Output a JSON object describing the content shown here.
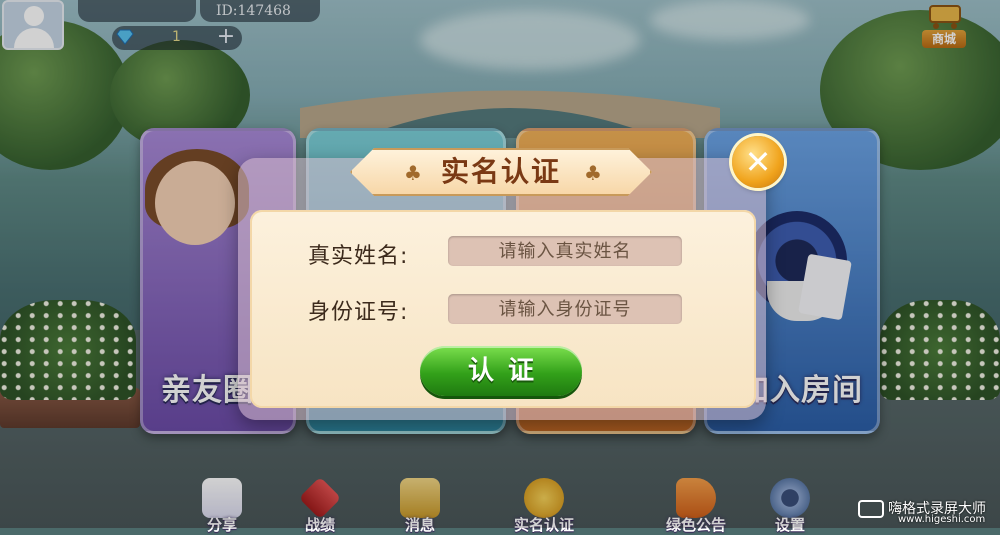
{
  "profile": {
    "id_text": "ID:147468",
    "diamonds": "1",
    "add_symbol": "+"
  },
  "shop": {
    "label": "商城"
  },
  "menu": {
    "cards": [
      {
        "label": "亲友圈"
      },
      {
        "label": ""
      },
      {
        "label": ""
      },
      {
        "label": "加入房间"
      }
    ]
  },
  "dialog": {
    "title": "实名认证",
    "name_label": "真实姓名:",
    "name_placeholder": "请输入真实姓名",
    "id_label": "身份证号:",
    "id_placeholder": "请输入身份证号",
    "submit_label": "认证",
    "close_symbol": "✕"
  },
  "dock": [
    {
      "label": "分享"
    },
    {
      "label": "战绩"
    },
    {
      "label": "消息"
    },
    {
      "label": "实名认证"
    },
    {
      "label": "绿色公告"
    },
    {
      "label": "设置"
    }
  ],
  "watermark": {
    "title": "嗨格式录屏大师",
    "url": "www.higeshi.com"
  },
  "colors": {
    "accent_green": "#33a11a",
    "close_gold": "#f0a31c",
    "title_brown": "#7a3914"
  }
}
